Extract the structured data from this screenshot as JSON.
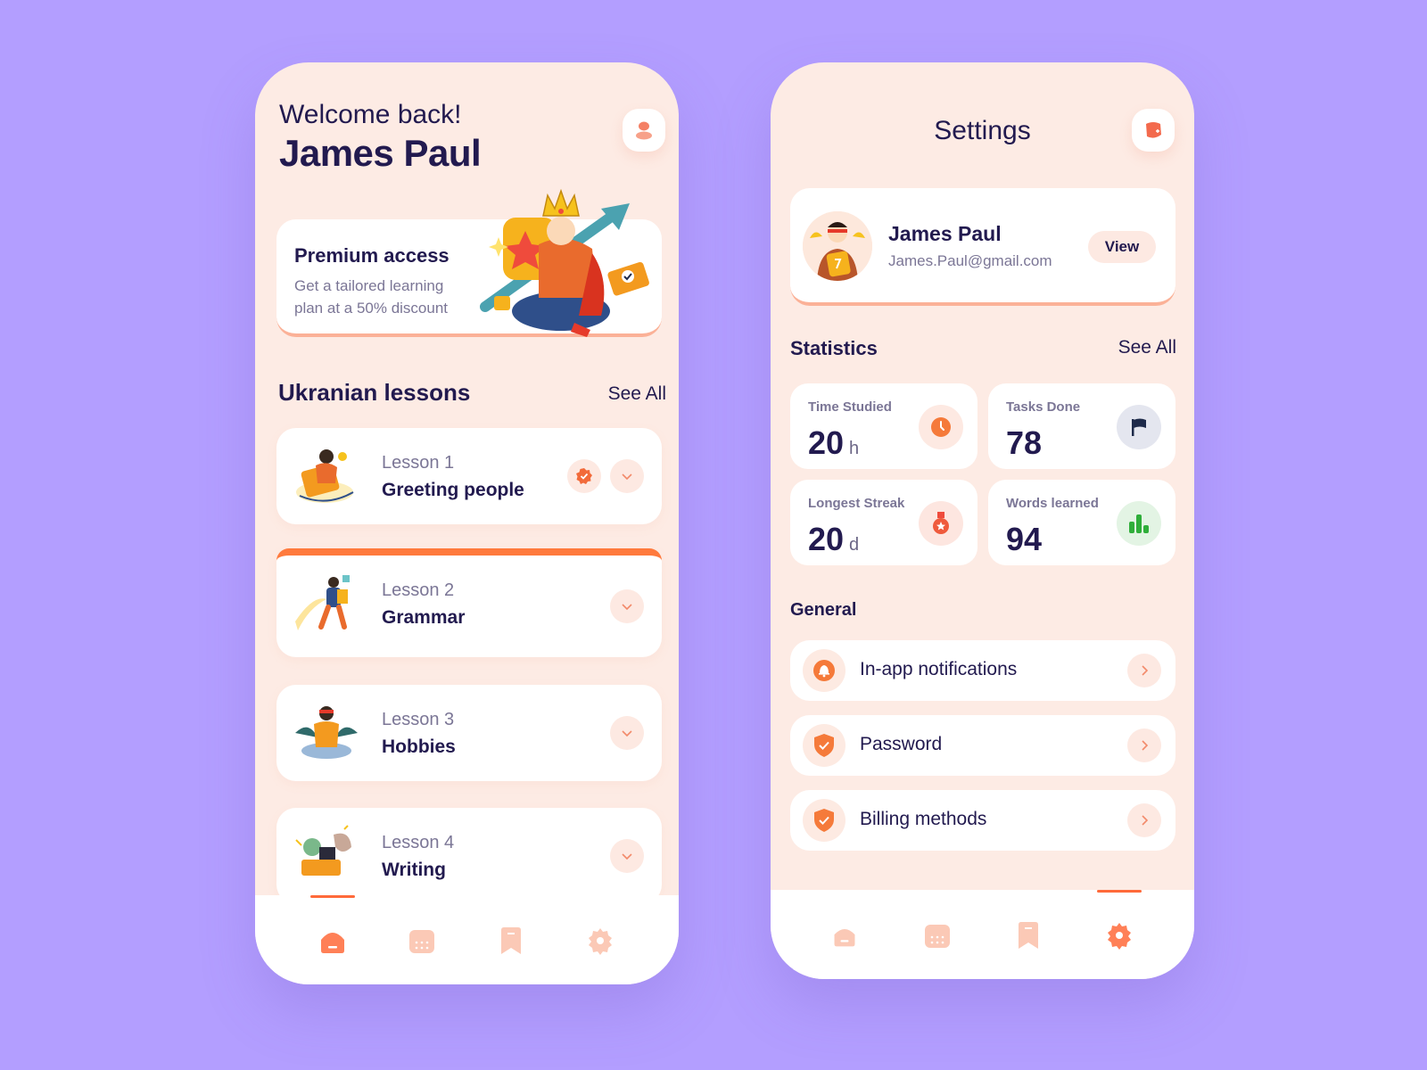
{
  "colors": {
    "background": "#b39eff",
    "phone_bg": "#fdebe4",
    "accent": "#ff6a3a",
    "text_dark": "#221a4f",
    "text_muted": "#7b7696",
    "icon_soft": "#fbc9b6",
    "green": "#2fae3a",
    "navy": "#1e2a4a"
  },
  "home": {
    "welcome": "Welcome back!",
    "user_name": "James Paul",
    "profile_icon": "user-icon",
    "premium": {
      "title": "Premium access",
      "description": "Get a tailored learning plan at a 50% discount"
    },
    "lessons_section": {
      "title": "Ukranian lessons",
      "see_all": "See All"
    },
    "lessons": [
      {
        "number": "Lesson 1",
        "title": "Greeting people",
        "completed": true,
        "active": false
      },
      {
        "number": "Lesson 2",
        "title": "Grammar",
        "completed": false,
        "active": true
      },
      {
        "number": "Lesson 3",
        "title": "Hobbies",
        "completed": false,
        "active": false
      },
      {
        "number": "Lesson 4",
        "title": "Writing",
        "completed": false,
        "active": false
      }
    ],
    "tabbar": {
      "tabs": [
        "home-icon",
        "calendar-icon",
        "bookmark-icon",
        "gear-icon"
      ],
      "active_index": 0
    }
  },
  "settings": {
    "title": "Settings",
    "add_icon": "add-icon",
    "profile": {
      "name": "James Paul",
      "email": "James.Paul@gmail.com",
      "view_label": "View"
    },
    "statistics": {
      "title": "Statistics",
      "see_all": "See All",
      "items": [
        {
          "label": "Time Studied",
          "value": "20",
          "unit": "h",
          "icon": "clock-icon"
        },
        {
          "label": "Tasks Done",
          "value": "78",
          "unit": "",
          "icon": "flag-icon"
        },
        {
          "label": "Longest Streak",
          "value": "20",
          "unit": "d",
          "icon": "medal-icon"
        },
        {
          "label": "Words learned",
          "value": "94",
          "unit": "",
          "icon": "bar-chart-icon"
        }
      ]
    },
    "general": {
      "title": "General",
      "items": [
        {
          "label": "In-app notifications",
          "icon": "bell-icon"
        },
        {
          "label": "Password",
          "icon": "shield-check-icon"
        },
        {
          "label": "Billing methods",
          "icon": "shield-check-icon"
        }
      ]
    },
    "tabbar": {
      "tabs": [
        "home-icon",
        "calendar-icon",
        "bookmark-icon",
        "gear-icon"
      ],
      "active_index": 3
    }
  }
}
